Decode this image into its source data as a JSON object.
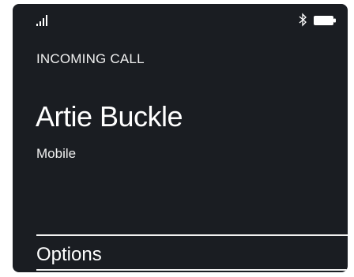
{
  "status_bar": {
    "signal_icon": "signal-bars-icon",
    "bluetooth_icon": "bluetooth-icon",
    "battery_icon": "battery-icon",
    "signal_level": 0.75,
    "battery_level": 1.0
  },
  "call": {
    "state_label": "INCOMING CALL",
    "caller_name": "Artie Buckle",
    "caller_type": "Mobile"
  },
  "softkeys": {
    "options_label": "Options"
  },
  "colors": {
    "screen_background": "#1a1d22",
    "text": "#ffffff",
    "divider": "#f2f2f2"
  }
}
